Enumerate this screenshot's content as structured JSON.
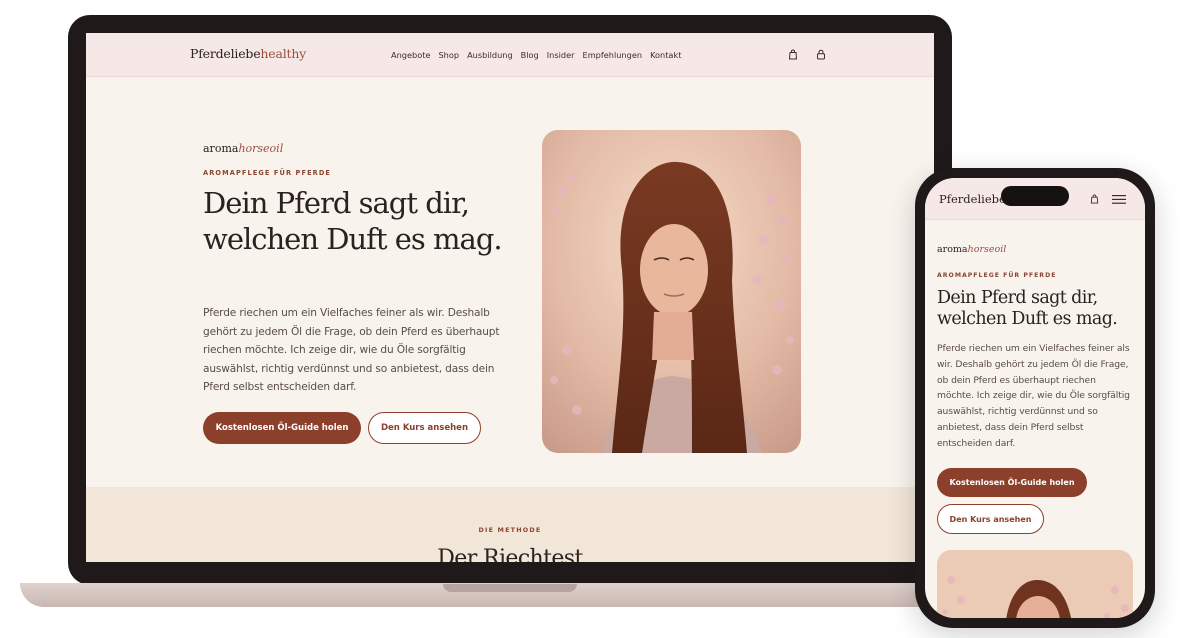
{
  "brand": {
    "name": "Pferdeliebe",
    "accent": "healthy"
  },
  "nav": {
    "items": [
      "Angebote",
      "Shop",
      "Ausbildung",
      "Blog",
      "Insider",
      "Empfehlungen",
      "Kontakt"
    ],
    "icons": [
      "shopping-bag-icon",
      "lock-icon",
      "menu-icon"
    ]
  },
  "hero": {
    "wordmark_prefix": "aroma",
    "wordmark_suffix": "horseoil",
    "eyebrow": "AROMAPFLEGE FÜR PFERDE",
    "title": "Dein Pferd sagt dir, welchen Duft es mag.",
    "body": "Pferde riechen um ein Vielfaches feiner als wir. Deshalb gehört zu jedem Öl die Frage, ob dein Pferd es überhaupt riechen möchte. Ich zeige dir, wie du Öle sorgfältig auswählst, richtig verdünnst und so anbietest, dass dein Pferd selbst entscheiden darf.",
    "primary_button": "Kostenlosen Öl-Guide holen",
    "secondary_button": "Den Kurs ansehen"
  },
  "method": {
    "eyebrow": "DIE METHODE",
    "title": "Der Riechtest"
  },
  "colors": {
    "primary": "#8c3f2a",
    "accent_text": "#9c4f3d",
    "page_bg": "#f9f3ee",
    "nav_bg": "#f6e8e6",
    "section_bg": "#f2e6d9",
    "device_frame": "#1f1a19"
  }
}
